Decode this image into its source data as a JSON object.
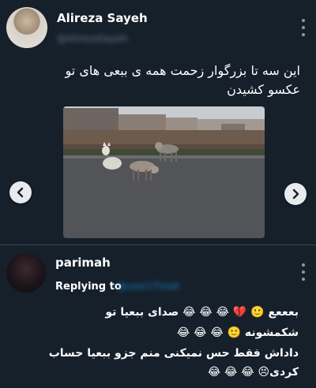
{
  "post1": {
    "author_name": "Alireza Sayeh",
    "author_handle": "@AlirezaSayeh",
    "text_line1": "این سه تا بزرگوار زحمت همه ی ببعی های تو",
    "text_line2": "عکسو کشیدن",
    "media": {
      "description_icon": "photo-three-wolves-on-street"
    }
  },
  "post2": {
    "author_name": "parimah",
    "replying_label": "Replying to",
    "replying_handle": "@user1Tmah",
    "line1": "بعععع 🙂 💔 😂 😂 😂 صدای ببعیا تو",
    "line2": "شکمشونه 🙂 😂 😂 😂",
    "line3": "داداش فقط حس نمیکنی منم جزو ببعیا حساب",
    "line4": "کردی😣 😂 😂 😂"
  },
  "icons": {
    "more": "more-vertical-icon",
    "prev": "chevron-left-icon",
    "next": "chevron-right-icon"
  },
  "colors": {
    "background": "#15202b",
    "divider": "#38444d",
    "secondary_text": "#8899a6",
    "link": "#1d9bf0"
  }
}
